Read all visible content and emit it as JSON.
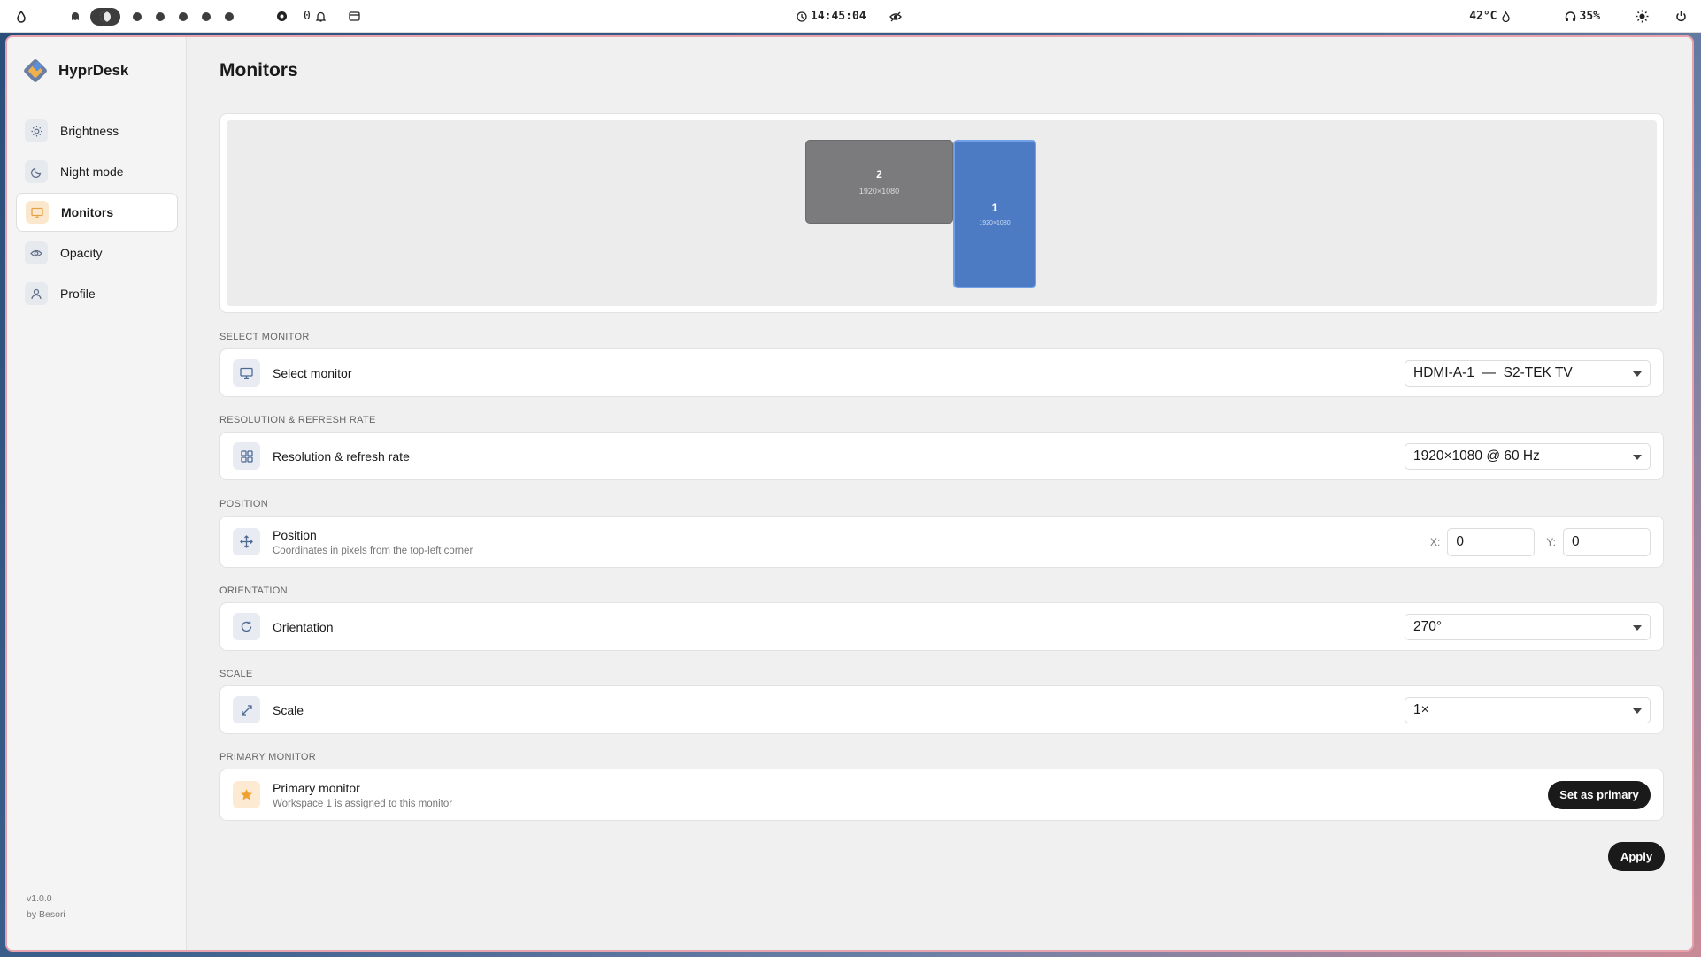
{
  "topbar": {
    "notif_count": "0",
    "clock": "14:45:04",
    "temperature": "42°C",
    "volume": "35%"
  },
  "sidebar": {
    "brand": "HyprDesk",
    "items": [
      {
        "label": "Brightness",
        "icon": "sun-icon"
      },
      {
        "label": "Night mode",
        "icon": "moon-icon"
      },
      {
        "label": "Monitors",
        "icon": "monitor-icon",
        "active": true
      },
      {
        "label": "Opacity",
        "icon": "eye-icon"
      },
      {
        "label": "Profile",
        "icon": "user-icon"
      }
    ],
    "version": "v1.0.0",
    "author": "by Besori"
  },
  "page": {
    "title": "Monitors",
    "preview": {
      "monitors": [
        {
          "num": "2",
          "res": "1920×1080"
        },
        {
          "num": "1",
          "res": "1920×1080",
          "selected": true
        }
      ]
    },
    "select_monitor": {
      "section": "SELECT MONITOR",
      "title": "Select monitor",
      "value": "HDMI-A-1  —  S2-TEK TV"
    },
    "resolution": {
      "section": "RESOLUTION & REFRESH RATE",
      "title": "Resolution & refresh rate",
      "value": "1920×1080 @ 60 Hz"
    },
    "position": {
      "section": "POSITION",
      "title": "Position",
      "subtitle": "Coordinates in pixels from the top-left corner",
      "x_label": "X:",
      "x_value": "0",
      "y_label": "Y:",
      "y_value": "0"
    },
    "orientation": {
      "section": "ORIENTATION",
      "title": "Orientation",
      "value": "270°"
    },
    "scale": {
      "section": "SCALE",
      "title": "Scale",
      "value": "1×"
    },
    "primary": {
      "section": "PRIMARY MONITOR",
      "title": "Primary monitor",
      "subtitle": "Workspace 1 is assigned to this monitor",
      "button": "Set as primary"
    },
    "apply_label": "Apply"
  },
  "colors": {
    "accent": "#4c7bc4",
    "primary_dark": "#1a1a1a",
    "window_border": "#e7a2ad"
  }
}
